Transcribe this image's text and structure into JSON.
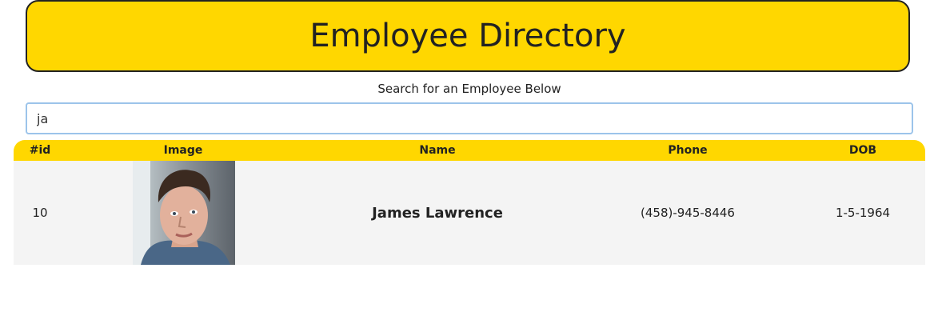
{
  "header": {
    "title": "Employee Directory"
  },
  "search": {
    "label": "Search for an Employee Below",
    "value": "ja",
    "placeholder": ""
  },
  "table": {
    "columns": [
      "#id",
      "Image",
      "Name",
      "Phone",
      "DOB"
    ],
    "rows": [
      {
        "id": "10",
        "image": "portrait-photo",
        "name": "James Lawrence",
        "phone": "(458)-945-8446",
        "dob": "1-5-1964"
      }
    ]
  },
  "colors": {
    "accent": "#FFD700",
    "row_bg": "#f4f4f4",
    "text": "#222222"
  }
}
